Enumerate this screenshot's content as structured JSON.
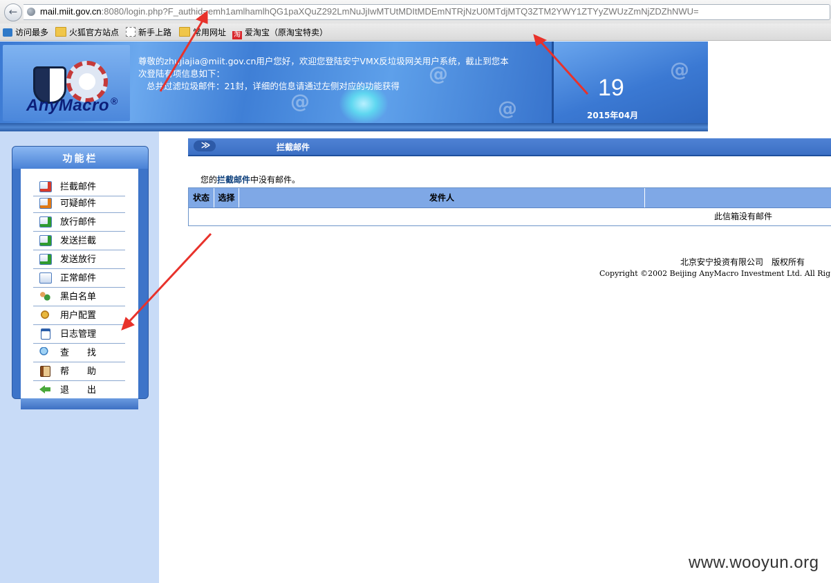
{
  "browser": {
    "url_host": "mail.miit.gov.cn",
    "url_rest": ":8080/login.php?F_authid=emh1amlhamlhQG1paXQuZ292LmNuJjIwMTUtMDItMDEmNTRjNzU0MTdjMTQ3ZTM2YWY1ZTYyZWUzZmNjZDZhNWU=",
    "bookmarks": [
      "访问最多",
      "火狐官方站点",
      "新手上路",
      "常用网址",
      "爱淘宝（原淘宝特卖）"
    ]
  },
  "banner": {
    "logo_text": "AnyMacro",
    "logo_reg": "®",
    "welcome_line1": "尊敬的zhujiajia@miit.gov.cn用户您好，欢迎您登陆安宁VMX反垃圾网关用户系统，截止到您本",
    "welcome_line2": "次登陆有项信息如下：",
    "welcome_line3": "总共过滤垃圾邮件：21封，详细的信息请通过左侧对应的功能获得",
    "day": "19",
    "year_month": "2015年04月"
  },
  "sidebar": {
    "title": "功能栏",
    "items": [
      {
        "label": "拦截邮件",
        "icon": "blocked-mail-icon"
      },
      {
        "label": "可疑邮件",
        "icon": "suspicious-mail-icon"
      },
      {
        "label": "放行邮件",
        "icon": "released-mail-icon"
      },
      {
        "label": "发送拦截",
        "icon": "send-blocked-icon"
      },
      {
        "label": "发送放行",
        "icon": "send-released-icon"
      },
      {
        "label": "正常邮件",
        "icon": "mail-icon"
      },
      {
        "label": "黑白名单",
        "icon": "people-icon"
      },
      {
        "label": "用户配置",
        "icon": "gear-icon"
      },
      {
        "label": "日志管理",
        "icon": "log-icon"
      },
      {
        "label": "查　　找",
        "icon": "search-icon"
      },
      {
        "label": "帮　　助",
        "icon": "help-book-icon"
      },
      {
        "label": "退　　出",
        "icon": "exit-arrow-icon"
      }
    ]
  },
  "main": {
    "section_title": "拦截邮件",
    "no_mail_prefix": "您的",
    "no_mail_link": "拦截邮件",
    "no_mail_suffix": "中没有邮件。",
    "table": {
      "headers": [
        "状态",
        "选择",
        "发件人",
        ""
      ],
      "empty_text": "此信箱没有邮件"
    }
  },
  "footer": {
    "company": "北京安宁投资有限公司　版权所有",
    "copyright": "Copyright ©2002 Beijing AnyMacro Investment Ltd. All Rig"
  },
  "watermark": "www.wooyun.org",
  "colors": {
    "banner_blue": "#3f7fd6",
    "sidebar_bg": "#c8dbf7",
    "table_header": "#7fa8e6",
    "annotation_arrow": "#e8322b"
  }
}
